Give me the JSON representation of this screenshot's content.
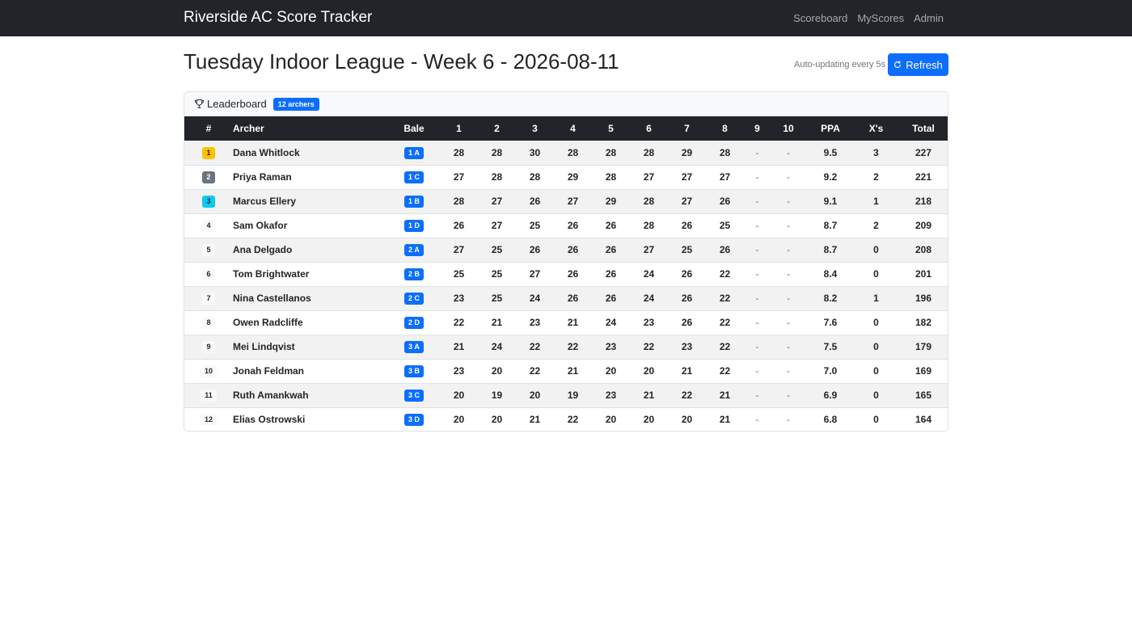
{
  "navbar": {
    "brand": "Riverside AC Score Tracker",
    "links": [
      "Scoreboard",
      "MyScores",
      "Admin"
    ]
  },
  "page": {
    "title": "Tuesday Indoor League - Week 6 - 2026-08-11",
    "auto_update": "Auto-updating every 5s",
    "refresh_label": "Refresh"
  },
  "leaderboard": {
    "label": "Leaderboard",
    "count_badge": "12 archers",
    "columns": [
      "#",
      "Archer",
      "Bale",
      "1",
      "2",
      "3",
      "4",
      "5",
      "6",
      "7",
      "8",
      "9",
      "10",
      "PPA",
      "X's",
      "Total"
    ],
    "rows": [
      {
        "rank": "1",
        "name": "Dana Whitlock",
        "bale": "1 A",
        "ends": [
          "28",
          "28",
          "30",
          "28",
          "28",
          "28",
          "29",
          "28",
          "-",
          "-"
        ],
        "ppa": "9.5",
        "xs": "3",
        "total": "227"
      },
      {
        "rank": "2",
        "name": "Priya Raman",
        "bale": "1 C",
        "ends": [
          "27",
          "28",
          "28",
          "29",
          "28",
          "27",
          "27",
          "27",
          "-",
          "-"
        ],
        "ppa": "9.2",
        "xs": "2",
        "total": "221"
      },
      {
        "rank": "3",
        "name": "Marcus Ellery",
        "bale": "1 B",
        "ends": [
          "28",
          "27",
          "26",
          "27",
          "29",
          "28",
          "27",
          "26",
          "-",
          "-"
        ],
        "ppa": "9.1",
        "xs": "1",
        "total": "218"
      },
      {
        "rank": "4",
        "name": "Sam Okafor",
        "bale": "1 D",
        "ends": [
          "26",
          "27",
          "25",
          "26",
          "26",
          "28",
          "26",
          "25",
          "-",
          "-"
        ],
        "ppa": "8.7",
        "xs": "2",
        "total": "209"
      },
      {
        "rank": "5",
        "name": "Ana Delgado",
        "bale": "2 A",
        "ends": [
          "27",
          "25",
          "26",
          "26",
          "26",
          "27",
          "25",
          "26",
          "-",
          "-"
        ],
        "ppa": "8.7",
        "xs": "0",
        "total": "208"
      },
      {
        "rank": "6",
        "name": "Tom Brightwater",
        "bale": "2 B",
        "ends": [
          "25",
          "25",
          "27",
          "26",
          "26",
          "24",
          "26",
          "22",
          "-",
          "-"
        ],
        "ppa": "8.4",
        "xs": "0",
        "total": "201"
      },
      {
        "rank": "7",
        "name": "Nina Castellanos",
        "bale": "2 C",
        "ends": [
          "23",
          "25",
          "24",
          "26",
          "26",
          "24",
          "26",
          "22",
          "-",
          "-"
        ],
        "ppa": "8.2",
        "xs": "1",
        "total": "196"
      },
      {
        "rank": "8",
        "name": "Owen Radcliffe",
        "bale": "2 D",
        "ends": [
          "22",
          "21",
          "23",
          "21",
          "24",
          "23",
          "26",
          "22",
          "-",
          "-"
        ],
        "ppa": "7.6",
        "xs": "0",
        "total": "182"
      },
      {
        "rank": "9",
        "name": "Mei Lindqvist",
        "bale": "3 A",
        "ends": [
          "21",
          "24",
          "22",
          "22",
          "23",
          "22",
          "23",
          "22",
          "-",
          "-"
        ],
        "ppa": "7.5",
        "xs": "0",
        "total": "179"
      },
      {
        "rank": "10",
        "name": "Jonah Feldman",
        "bale": "3 B",
        "ends": [
          "23",
          "20",
          "22",
          "21",
          "20",
          "20",
          "21",
          "22",
          "-",
          "-"
        ],
        "ppa": "7.0",
        "xs": "0",
        "total": "169"
      },
      {
        "rank": "11",
        "name": "Ruth Amankwah",
        "bale": "3 C",
        "ends": [
          "20",
          "19",
          "20",
          "19",
          "23",
          "21",
          "22",
          "21",
          "-",
          "-"
        ],
        "ppa": "6.9",
        "xs": "0",
        "total": "165"
      },
      {
        "rank": "12",
        "name": "Elias Ostrowski",
        "bale": "3 D",
        "ends": [
          "20",
          "20",
          "21",
          "22",
          "20",
          "20",
          "20",
          "21",
          "-",
          "-"
        ],
        "ppa": "6.8",
        "xs": "0",
        "total": "164"
      }
    ]
  },
  "icons": {
    "refresh": "refresh-icon",
    "trophy": "trophy-icon"
  },
  "colors": {
    "navbar_bg": "#212529",
    "primary": "#0d6efd",
    "gold": "#ffc107",
    "silver": "#6c757d",
    "bronze": "#0dcaf0"
  }
}
